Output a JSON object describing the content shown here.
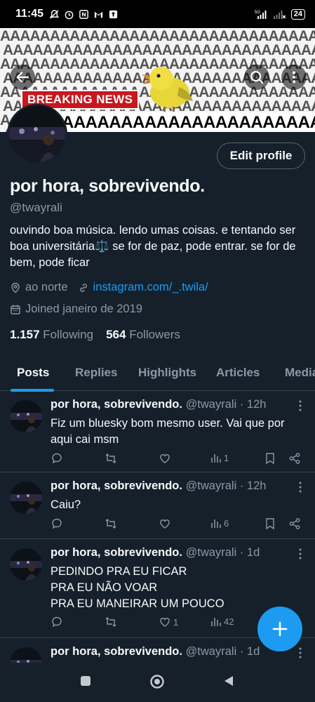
{
  "status_bar": {
    "time": "11:45",
    "network": "5G",
    "battery": "24"
  },
  "banner": {
    "breaking_news": "BREAKING NEWS",
    "scream": "AAAAAAAAAAAAAAAAAAAAAAAA",
    "pattern_letter": "A"
  },
  "profile": {
    "edit_button": "Edit profile",
    "display_name": "por hora, sobrevivendo.",
    "handle": "@twayrali",
    "bio": "ouvindo boa música. lendo umas coisas. e tentando ser boa universitária⚖️  se for de paz, pode entrar. se for de bem, pode ficar",
    "location": "ao norte",
    "link": "instagram.com/_.twila/",
    "joined": "Joined janeiro de 2019",
    "following_count": "1.157",
    "following_label": "Following",
    "followers_count": "564",
    "followers_label": "Followers"
  },
  "tabs": [
    {
      "label": "Posts",
      "active": true
    },
    {
      "label": "Replies",
      "active": false
    },
    {
      "label": "Highlights",
      "active": false
    },
    {
      "label": "Articles",
      "active": false
    },
    {
      "label": "Media",
      "active": false
    }
  ],
  "tweets": [
    {
      "name": "por hora, sobrevivendo.",
      "meta": "@twayrali · 12h",
      "text": "Fiz um bluesky bom mesmo user. Vai que por aqui cai msm",
      "likes": "",
      "views": "1"
    },
    {
      "name": "por hora, sobrevivendo.",
      "meta": "@twayrali · 12h",
      "text": "Caiu?",
      "likes": "",
      "views": "6"
    },
    {
      "name": "por hora, sobrevivendo.",
      "meta": "@twayrali · 1d",
      "text_lines": [
        "PEDINDO PRA EU FICAR",
        "PRA EU NÃO VOAR",
        "PRA EU MANEIRAR UM POUCO"
      ],
      "likes": "1",
      "views": "42"
    },
    {
      "name": "por hora, sobrevivendo.",
      "meta": "@twayrali · 1d"
    }
  ],
  "colors": {
    "background": "#15202b",
    "accent": "#1d9bf0",
    "muted": "#8b98a5",
    "divider": "#38444d",
    "breaking_red": "#c8171e"
  },
  "icons": {
    "back": "arrow-left-icon",
    "search": "search-icon",
    "more": "more-vertical-icon",
    "location": "location-pin-icon",
    "link": "link-icon",
    "calendar": "calendar-icon",
    "reply": "reply-icon",
    "retweet": "retweet-icon",
    "like": "heart-icon",
    "views": "bar-chart-icon",
    "bookmark": "bookmark-icon",
    "share": "share-icon",
    "compose": "plus-icon"
  }
}
